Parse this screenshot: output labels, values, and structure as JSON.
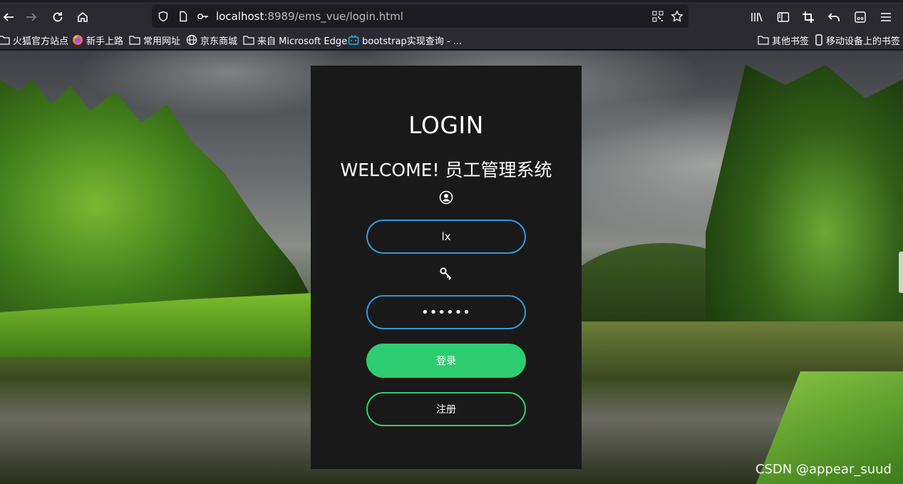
{
  "browser": {
    "url_host": "localhost",
    "url_rest": ":8989/ems_vue/login.html",
    "bookmarks": [
      {
        "label": "火狐官方站点",
        "icon": "folder-icon"
      },
      {
        "label": "新手上路",
        "icon": "firefox-icon"
      },
      {
        "label": "常用网址",
        "icon": "folder-icon"
      },
      {
        "label": "京东商城",
        "icon": "globe-icon"
      },
      {
        "label": "来自 Microsoft Edge",
        "icon": "folder-icon"
      },
      {
        "label": "bootstrap实现查询 - ...",
        "icon": "bilibili-icon"
      }
    ],
    "other_bookmarks": "其他书签",
    "mobile_bookmarks": "移动设备上的书签"
  },
  "login": {
    "title": "LOGIN",
    "subtitle": "WELCOME! 员工管理系统",
    "username_value": "lx",
    "password_value": "••••••",
    "login_button": "登录",
    "register_button": "注册"
  },
  "watermark": "CSDN @appear_suud",
  "colors": {
    "card_bg": "#191919",
    "input_border": "#3498db",
    "button_green": "#2ecc71",
    "chrome_bg": "#2b2a33"
  }
}
